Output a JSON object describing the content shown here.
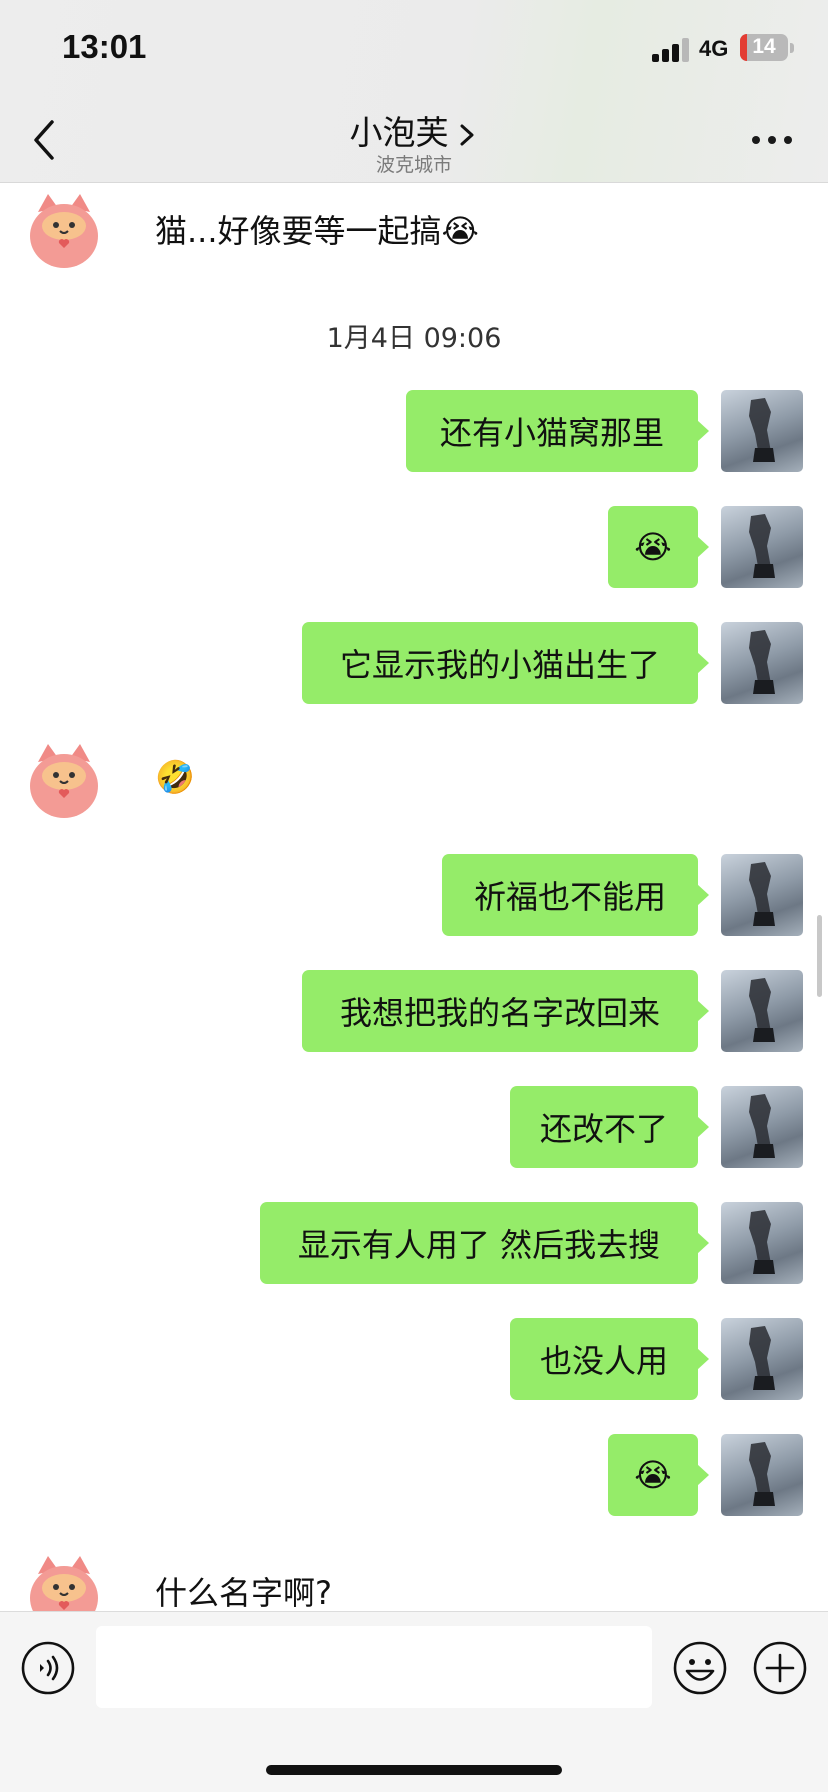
{
  "status_bar": {
    "time": "13:01",
    "network": "4G",
    "battery": "14",
    "battery_level": 0.14
  },
  "header": {
    "title": "小泡芙",
    "subtitle": "波克城市"
  },
  "messages": [
    {
      "side": "left",
      "text": "猫...好像要等一起搞😭"
    },
    {
      "type": "timestamp",
      "text": "1月4日 09:06"
    },
    {
      "side": "right",
      "text": "还有小猫窝那里"
    },
    {
      "side": "right",
      "text": "😭"
    },
    {
      "side": "right",
      "text": "它显示我的小猫出生了"
    },
    {
      "side": "left",
      "text": "🤣"
    },
    {
      "side": "right",
      "text": "祈福也不能用"
    },
    {
      "side": "right",
      "text": "我想把我的名字改回来"
    },
    {
      "side": "right",
      "text": "还改不了"
    },
    {
      "side": "right",
      "text": "显示有人用了 然后我去搜"
    },
    {
      "side": "right",
      "text": "也没人用"
    },
    {
      "side": "right",
      "text": "😭"
    },
    {
      "side": "left",
      "text": "什么名字啊?"
    }
  ],
  "icons": {
    "back": "chevron-left-icon",
    "more": "more-dots-icon",
    "voice": "voice-icon",
    "emoji": "emoji-icon",
    "plus": "plus-icon"
  },
  "colors": {
    "bubble_self": "#95ec69",
    "header_bg": "#ededed",
    "battery_low": "#e33d33"
  }
}
